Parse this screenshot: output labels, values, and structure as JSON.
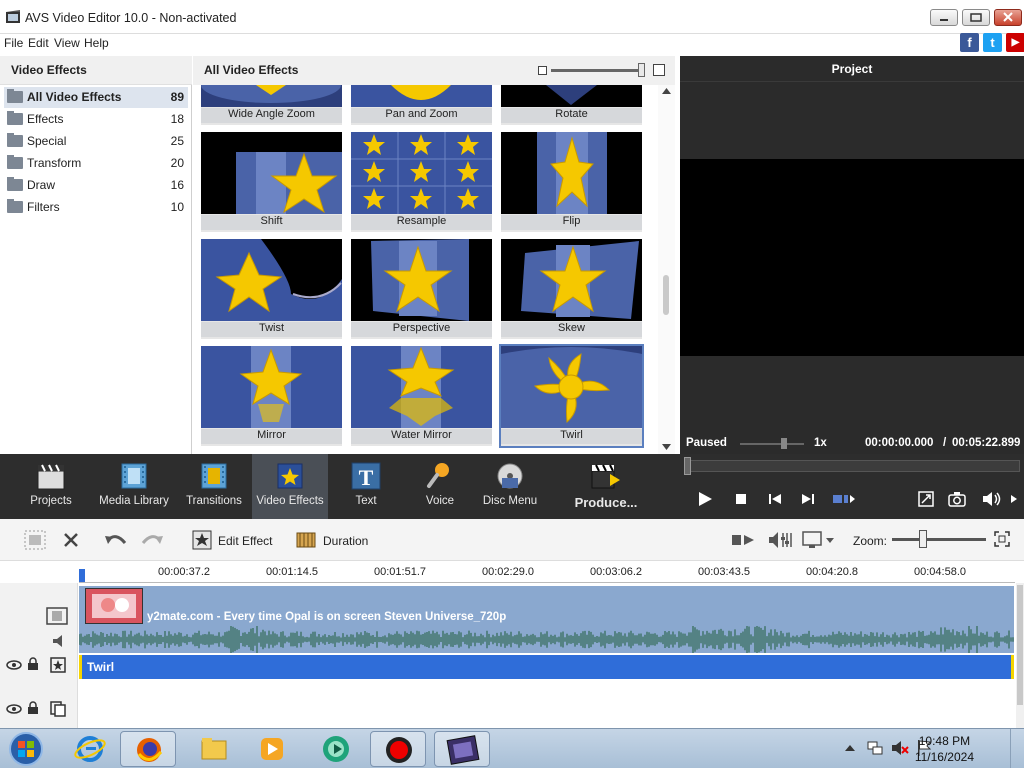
{
  "window": {
    "title": "AVS Video Editor 10.0 - Non-activated"
  },
  "menu": [
    "File",
    "Edit",
    "View",
    "Help"
  ],
  "social": [
    {
      "name": "facebook",
      "glyph": "f",
      "color": "#3b5998"
    },
    {
      "name": "twitter",
      "glyph": "t",
      "color": "#1da1f2"
    },
    {
      "name": "youtube",
      "glyph": "▶",
      "color": "#cc0000"
    }
  ],
  "left_panel": {
    "title": "Video Effects",
    "categories": [
      {
        "label": "All Video Effects",
        "count": "89",
        "selected": true
      },
      {
        "label": "Effects",
        "count": "18"
      },
      {
        "label": "Special",
        "count": "25"
      },
      {
        "label": "Transform",
        "count": "20"
      },
      {
        "label": "Draw",
        "count": "16"
      },
      {
        "label": "Filters",
        "count": "10"
      }
    ]
  },
  "center_panel": {
    "title": "All Video Effects",
    "effects": [
      "Wide Angle Zoom",
      "Pan and Zoom",
      "Rotate",
      "Shift",
      "Resample",
      "Flip",
      "Twist",
      "Perspective",
      "Skew",
      "Mirror",
      "Water Mirror",
      "Twirl"
    ],
    "selected": "Twirl"
  },
  "preview": {
    "title": "Project",
    "status": "Paused",
    "speed": "1x",
    "time_current": "00:00:00.000",
    "time_separator": "/",
    "time_total": "00:05:22.899"
  },
  "toolbar": {
    "items": [
      "Projects",
      "Media Library",
      "Transitions",
      "Video Effects",
      "Text",
      "Voice",
      "Disc Menu",
      "Produce..."
    ],
    "selected": "Video Effects"
  },
  "timeline_tools": {
    "edit_effect": "Edit Effect",
    "duration": "Duration",
    "zoom_label": "Zoom:"
  },
  "ruler": [
    "00:00:37.2",
    "00:01:14.5",
    "00:01:51.7",
    "00:02:29.0",
    "00:03:06.2",
    "00:03:43.5",
    "00:04:20.8",
    "00:04:58.0"
  ],
  "timeline": {
    "video_clip_name": "y2mate.com - Every time Opal is on screen Steven Universe_720p",
    "effect_clip_name": "Twirl"
  },
  "taskbar": {
    "time": "10:48 PM",
    "date": "11/16/2024",
    "apps": [
      "start",
      "internet-explorer",
      "firefox",
      "file-explorer",
      "media-player",
      "app-green",
      "recorder",
      "avs-video-editor"
    ]
  }
}
